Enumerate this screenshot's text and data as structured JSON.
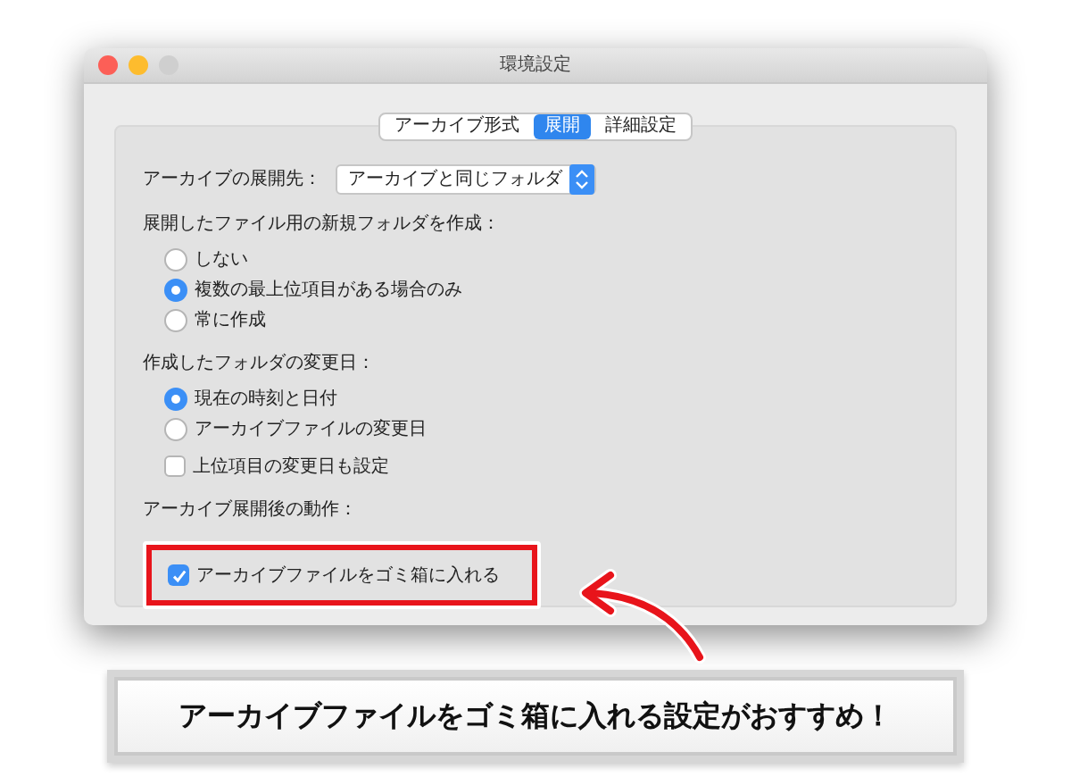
{
  "window": {
    "title": "環境設定"
  },
  "tabs": [
    {
      "label": "アーカイブ形式",
      "selected": false
    },
    {
      "label": "展開",
      "selected": true
    },
    {
      "label": "詳細設定",
      "selected": false
    }
  ],
  "destination": {
    "label": "アーカイブの展開先：",
    "value": "アーカイブと同じフォルダ"
  },
  "sections": [
    {
      "heading": "展開したファイル用の新規フォルダを作成：",
      "items": [
        {
          "kind": "radio",
          "label": "しない",
          "selected": false
        },
        {
          "kind": "radio",
          "label": "複数の最上位項目がある場合のみ",
          "selected": true
        },
        {
          "kind": "radio",
          "label": "常に作成",
          "selected": false
        }
      ]
    },
    {
      "heading": "作成したフォルダの変更日：",
      "items": [
        {
          "kind": "radio",
          "label": "現在の時刻と日付",
          "selected": true
        },
        {
          "kind": "radio",
          "label": "アーカイブファイルの変更日",
          "selected": false
        },
        {
          "kind": "checkbox",
          "label": "上位項目の変更日も設定",
          "checked": false
        }
      ]
    },
    {
      "heading": "アーカイブ展開後の動作：",
      "items": [
        {
          "kind": "checkbox",
          "label": "アーカイブファイルをゴミ箱に入れる",
          "checked": true,
          "highlighted": true
        }
      ]
    }
  ],
  "caption": "アーカイブファイルをゴミ箱に入れる設定がおすすめ！"
}
